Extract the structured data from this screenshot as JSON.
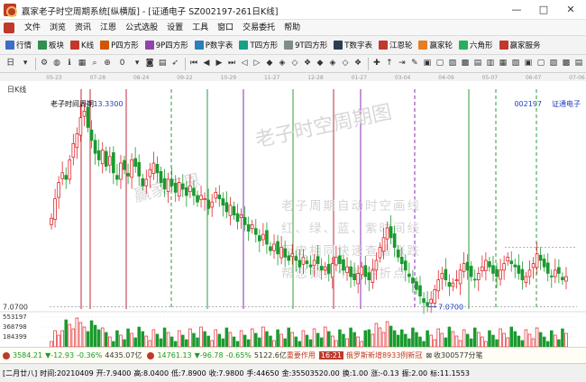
{
  "window": {
    "title": "赢家老子时空周期系统[纵横版] - [证通电子  SZ002197-261日K线]",
    "minimize": "—",
    "maximize": "□",
    "close": "✕"
  },
  "menu": [
    "文件",
    "浏览",
    "资讯",
    "江恩",
    "公式选股",
    "设置",
    "工具",
    "窗口",
    "交易委托",
    "帮助"
  ],
  "toolbar_primary": [
    {
      "label": "行情",
      "icon": "grid-icon",
      "color": "#3b6fc4"
    },
    {
      "label": "板块",
      "icon": "blocks-icon",
      "color": "#2f8f4e"
    },
    {
      "label": "K线",
      "icon": "candlestick-icon",
      "color": "#c0392b"
    },
    {
      "label": "P四方形",
      "icon": "square-p-icon",
      "color": "#d35400"
    },
    {
      "label": "9P四方形",
      "icon": "square-9p-icon",
      "color": "#8e44ad"
    },
    {
      "label": "P数字表",
      "icon": "table-p-icon",
      "color": "#2c7fb8"
    },
    {
      "label": "T四方形",
      "icon": "square-t-icon",
      "color": "#16a085"
    },
    {
      "label": "9T四方形",
      "icon": "square-9t-icon",
      "color": "#7f8c8d"
    },
    {
      "label": "T数字表",
      "icon": "table-t-icon",
      "color": "#2c3e50"
    },
    {
      "label": "江恩轮",
      "icon": "gann-wheel-icon",
      "color": "#c0392b"
    },
    {
      "label": "赢家轮",
      "icon": "winner-wheel-icon",
      "color": "#e67e22"
    },
    {
      "label": "六角形",
      "icon": "hexagon-icon",
      "color": "#27ae60"
    },
    {
      "label": "赢家服务",
      "icon": "service-icon",
      "color": "#c0392b"
    }
  ],
  "toolbar_secondary": {
    "period_label": "日",
    "zero_label": "0"
  },
  "chart": {
    "period": "日K线",
    "stock_code": "002197",
    "stock_name": "证通电子",
    "indicator_name": "老子时间周期",
    "high_label": "13.3300",
    "low_label": "7.0700",
    "price_axis_label": "7.0700",
    "volume_labels": [
      "553197",
      "368798",
      "184399"
    ],
    "watermark_main": "老子时空周期图",
    "watermark_brand": "赢家江恩",
    "watermark_lines": [
      "老子周期自动时空画线",
      "红、绿、蓝、紫时间线",
      "历史相同快速查看涨跌",
      "帮您预判个股转折点"
    ],
    "date_ticks": [
      "05-23",
      "07-28",
      "08-24",
      "09-22",
      "10-29",
      "11-27",
      "12-28",
      "01-27",
      "03-04",
      "04-09",
      "05-07",
      "06-07",
      "07-06"
    ],
    "colors": {
      "up": "#e0262a",
      "down": "#1a9a2e",
      "red_line": "#c0283a",
      "green_line": "#2f9b3a",
      "blue_line": "#1e3fbf",
      "purple_line": "#8a2bb5"
    }
  },
  "chart_data": {
    "type": "candlestick",
    "title": "老子时间周期",
    "ylabel": "",
    "xlabel": "",
    "ylim": [
      7.0,
      13.5
    ],
    "extrema": {
      "high": 13.33,
      "low": 7.07
    },
    "series": [
      {
        "name": "",
        "close": [
          9.8,
          10.4,
          10.9,
          11.2,
          11.0,
          11.6,
          12.1,
          12.4,
          12.9,
          13.1,
          12.6,
          12.2,
          11.8,
          11.6,
          11.9,
          11.4,
          11.7,
          11.2,
          11.0,
          11.5,
          11.3,
          11.1,
          11.6,
          11.4,
          11.1,
          10.8,
          11.0,
          11.3,
          11.5,
          11.2,
          10.9,
          10.7,
          11.0,
          10.8,
          10.6,
          10.9,
          10.7,
          10.5,
          10.8,
          10.5,
          10.3,
          10.5,
          10.4,
          10.1,
          10.3,
          10.6,
          10.4,
          10.2,
          10.0,
          10.2,
          9.9,
          9.7,
          9.9,
          9.6,
          9.4,
          9.6,
          9.3,
          9.1,
          9.3,
          9.0,
          8.8,
          9.0,
          8.7,
          8.9,
          8.6,
          8.5,
          8.7,
          8.5,
          8.3,
          8.6,
          8.4,
          8.3,
          8.5,
          8.4,
          8.2,
          8.3,
          8.1,
          8.4,
          8.6,
          8.4,
          8.2,
          8.3,
          8.0,
          7.9,
          8.1,
          8.3,
          8.0,
          7.9,
          8.2,
          8.5,
          8.9,
          9.2,
          9.5,
          9.2,
          8.9,
          8.6,
          8.4,
          8.2,
          8.0,
          7.8,
          7.6,
          7.4,
          7.2,
          7.1,
          7.3,
          7.6,
          7.9,
          8.1,
          7.9,
          7.7,
          7.8,
          7.9,
          8.2,
          8.4,
          8.2,
          8.0,
          7.9,
          8.1,
          8.3,
          8.5,
          8.3,
          8.1,
          8.0,
          8.2,
          8.4,
          8.6,
          8.4,
          8.3,
          8.1,
          7.9,
          8.0,
          8.2,
          8.4,
          8.7,
          8.5,
          8.3,
          8.1,
          8.0,
          8.2,
          8.1,
          7.9,
          8.0
        ]
      }
    ],
    "volume_ticks": [
      553197,
      368798,
      184399
    ],
    "period": "日K线"
  },
  "status_top": {
    "sh_index": "3584.21",
    "sh_change": "▼-12.93",
    "sh_pct": "-0.36%",
    "sh_amount": "4435.07亿",
    "sz_index": "14761.13",
    "sz_change": "▼-96.78",
    "sz_pct": "-0.65%",
    "sz_amount": "5122.6亿",
    "tag_important": "重要作用",
    "tag_count": "16:21",
    "news": "俄罗斯新增8933例新冠",
    "receive": "收300577分笔"
  },
  "status_bottom": {
    "lunar_date": "[二月廿八]",
    "time": "时间:20210409",
    "open": "开:7.9400",
    "high": "高:8.0400",
    "low": "低:7.8900",
    "close": "收:7.9800",
    "hand": "手:44650",
    "amount": "金:35503520.00",
    "change": "换:1.00",
    "diff": "涨:-0.13",
    "amp": "振:2.00",
    "marker": "标:11.1553"
  }
}
